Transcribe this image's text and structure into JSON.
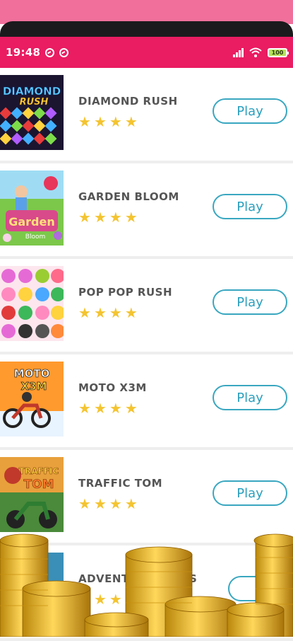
{
  "status_bar": {
    "time": "19:48",
    "battery": "100"
  },
  "games": [
    {
      "name": "DIAMOND RUSH",
      "rating": 4,
      "play_label": "Play",
      "thumb_title": "DIAMOND",
      "thumb_subtitle": "RUSH"
    },
    {
      "name": "GARDEN BLOOM",
      "rating": 4,
      "play_label": "Play",
      "thumb_title": "Garden",
      "thumb_subtitle": "Bloom"
    },
    {
      "name": "POP POP RUSH",
      "rating": 4,
      "play_label": "Play",
      "thumb_title": "",
      "thumb_subtitle": ""
    },
    {
      "name": "MOTO X3M",
      "rating": 4,
      "play_label": "Play",
      "thumb_title": "MOTO",
      "thumb_subtitle": "X3M"
    },
    {
      "name": "TRAFFIC TOM",
      "rating": 4,
      "play_label": "Play",
      "thumb_title": "TRAFFIC",
      "thumb_subtitle": "TOM"
    },
    {
      "name": "ADVENT",
      "name_tail": "RS",
      "rating": 4,
      "play_label": ""
    }
  ],
  "colors": {
    "status_bar": "#ea1c62",
    "play_border": "#39a7c0",
    "star": "#f4c430"
  }
}
